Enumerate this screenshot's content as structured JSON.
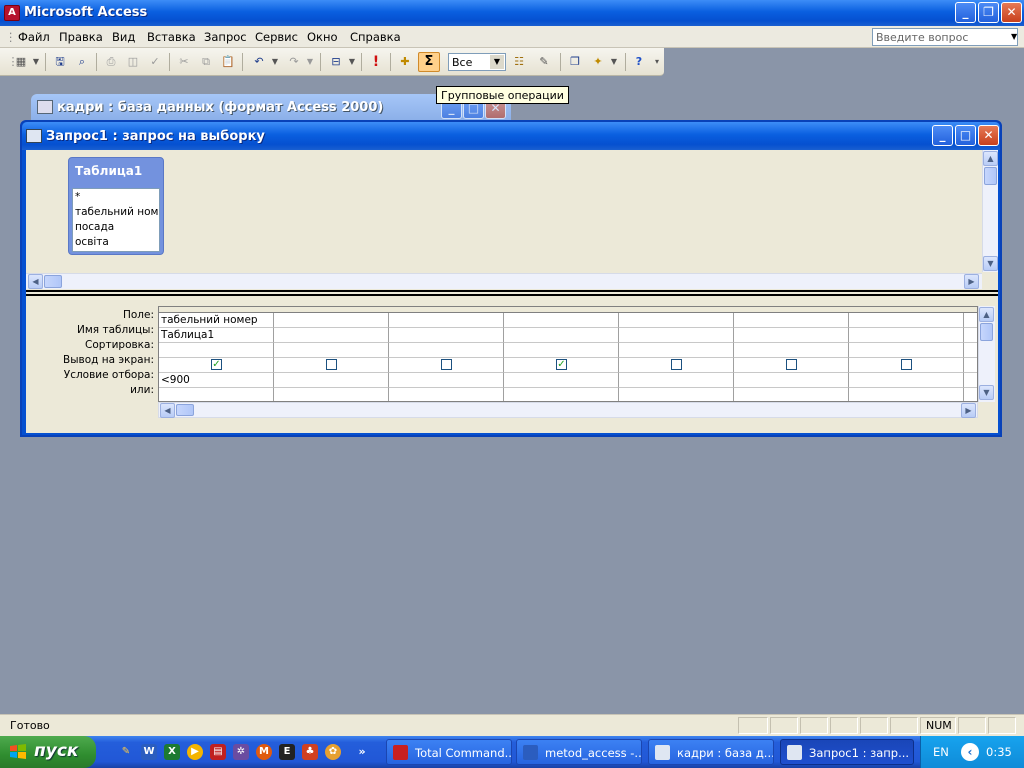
{
  "app": {
    "title": "Microsoft Access"
  },
  "menu": {
    "items": [
      "Файл",
      "Правка",
      "Вид",
      "Вставка",
      "Запрос",
      "Сервис",
      "Окно",
      "Справка"
    ],
    "help_placeholder": "Введите вопрос"
  },
  "toolbar": {
    "totals_icon": "Σ",
    "combo_value": "Все",
    "tooltip": "Групповые операции"
  },
  "db_window": {
    "title": "кадри : база данных (формат Access 2000)"
  },
  "query_window": {
    "title": "Запрос1 : запрос на выборку",
    "table": {
      "name": "Таблица1",
      "fields": [
        "*",
        "табельний номер",
        "посада",
        "освіта"
      ]
    },
    "row_labels": [
      "Поле:",
      "Имя таблицы:",
      "Сортировка:",
      "Вывод на экран:",
      "Условие отбора:",
      "или:"
    ],
    "columns": [
      {
        "field": "табельний номер",
        "table": "Таблица1",
        "sort": "",
        "show": true,
        "criteria": "<900",
        "or": ""
      },
      {
        "field": "",
        "table": "",
        "sort": "",
        "show": false,
        "criteria": "",
        "or": ""
      },
      {
        "field": "",
        "table": "",
        "sort": "",
        "show": false,
        "criteria": "",
        "or": ""
      },
      {
        "field": "",
        "table": "",
        "sort": "",
        "show": true,
        "criteria": "",
        "or": ""
      },
      {
        "field": "",
        "table": "",
        "sort": "",
        "show": false,
        "criteria": "",
        "or": ""
      },
      {
        "field": "",
        "table": "",
        "sort": "",
        "show": false,
        "criteria": "",
        "or": ""
      },
      {
        "field": "",
        "table": "",
        "sort": "",
        "show": false,
        "criteria": "",
        "or": ""
      },
      {
        "field": "",
        "table": "",
        "sort": "",
        "show": null,
        "criteria": "",
        "or": ""
      }
    ]
  },
  "status": {
    "text": "Готово",
    "num": "NUM"
  },
  "taskbar": {
    "start": "пуск",
    "tasks": [
      {
        "label": "Total Command...",
        "active": false
      },
      {
        "label": "metod_access -...",
        "active": false
      },
      {
        "label": "кадри : база д...",
        "active": false
      },
      {
        "label": "Запрос1 : запр...",
        "active": true
      }
    ],
    "lang": "EN",
    "clock": "0:35"
  }
}
